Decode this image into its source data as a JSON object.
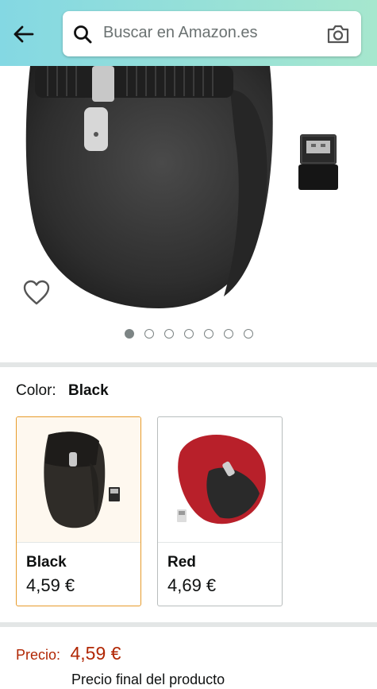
{
  "header": {
    "back_icon": "arrow-left-icon",
    "search_placeholder": "Buscar en Amazon.es",
    "search_icon": "search-icon",
    "camera_icon": "camera-icon",
    "gradient_colors": [
      "#84d8e3",
      "#a6e7ce"
    ]
  },
  "gallery": {
    "image_count": 7,
    "active_index": 0,
    "wishlist_icon": "heart-icon"
  },
  "variation": {
    "label": "Color:",
    "selected": "Black",
    "options": [
      {
        "name": "Black",
        "price": "4,59 €",
        "selected": true
      },
      {
        "name": "Red",
        "price": "4,69 €",
        "selected": false
      }
    ]
  },
  "pricing": {
    "label": "Precio:",
    "value": "4,59 €",
    "note": "Precio final del producto",
    "price_color": "#b12704"
  },
  "colors": {
    "selected_border": "#e79b2b"
  }
}
